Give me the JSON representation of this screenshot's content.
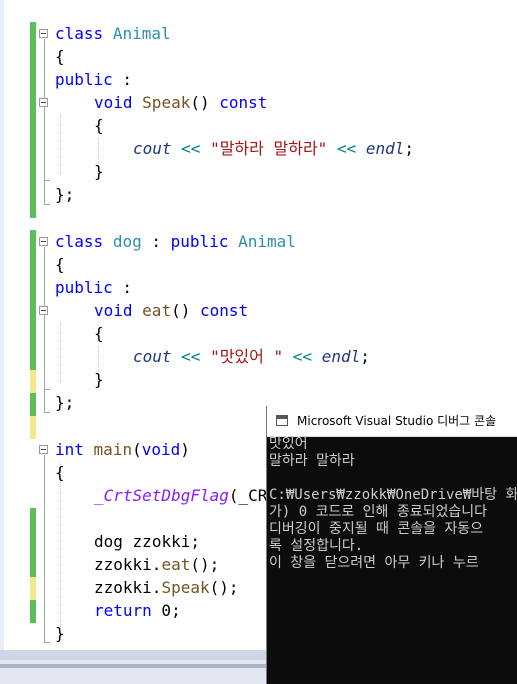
{
  "code": {
    "class_animal": {
      "kw_class": "class",
      "name": "Animal",
      "open": "{",
      "access": "public",
      "colon": " :",
      "ret": "void",
      "method": "Speak",
      "paren": "()",
      "const": "const",
      "m_open": "{",
      "cout": "cout",
      "op1": "<<",
      "str": "\"말하라 말하라\"",
      "op2": "<<",
      "endl": "endl",
      "semi": ";",
      "m_close": "}",
      "close": "};"
    },
    "class_dog": {
      "kw_class": "class",
      "name": "dog",
      "colon_base": " : ",
      "base_access": "public",
      "base": "Animal",
      "open": "{",
      "access": "public",
      "colon": " :",
      "ret": "void",
      "method": "eat",
      "paren": "()",
      "const": "const",
      "m_open": "{",
      "cout": "cout",
      "op1": "<<",
      "str": "\"맛있어 \"",
      "op2": "<<",
      "endl": "endl",
      "semi": ";",
      "m_close": "}",
      "close": "};"
    },
    "main": {
      "ret": "int",
      "name": "main",
      "lp": "(",
      "param": "void",
      "rp": ")",
      "open": "{",
      "macro": "_CrtSetDbgFlag",
      "macro_rest": "(_CR",
      "decl_type": "dog",
      "decl_var": "zzokki",
      "decl_semi": ";",
      "call1_obj": "zzokki",
      "call1_fn": "eat",
      "call1_rest": "();",
      "call2_obj": "zzokki",
      "call2_fn": "Speak",
      "call2_rest": "();",
      "ret_kw": "return",
      "ret_val": " 0;",
      "close": "}"
    }
  },
  "console": {
    "title": "Microsoft Visual Studio 디버그 콘솔",
    "lines": [
      "맛있어",
      "말하라 말하라",
      "",
      "C:₩Users₩zzokk₩OneDrive₩바탕 화",
      "가) 0 코드로 인해 종료되었습니다",
      "디버깅이 중지될 때 콘솔을 자동으",
      "록 설정합니다.",
      "이 창을 닫으려면 아무 키나 누르"
    ]
  },
  "colors": {
    "keyword": "#0000ff",
    "type": "#2b91af",
    "function": "#74531f",
    "string": "#a31515",
    "variable": "#1f377f",
    "macro": "#8a1bff",
    "changed_saved": "#5fbd5c",
    "changed_unsaved": "#f1e98a"
  }
}
